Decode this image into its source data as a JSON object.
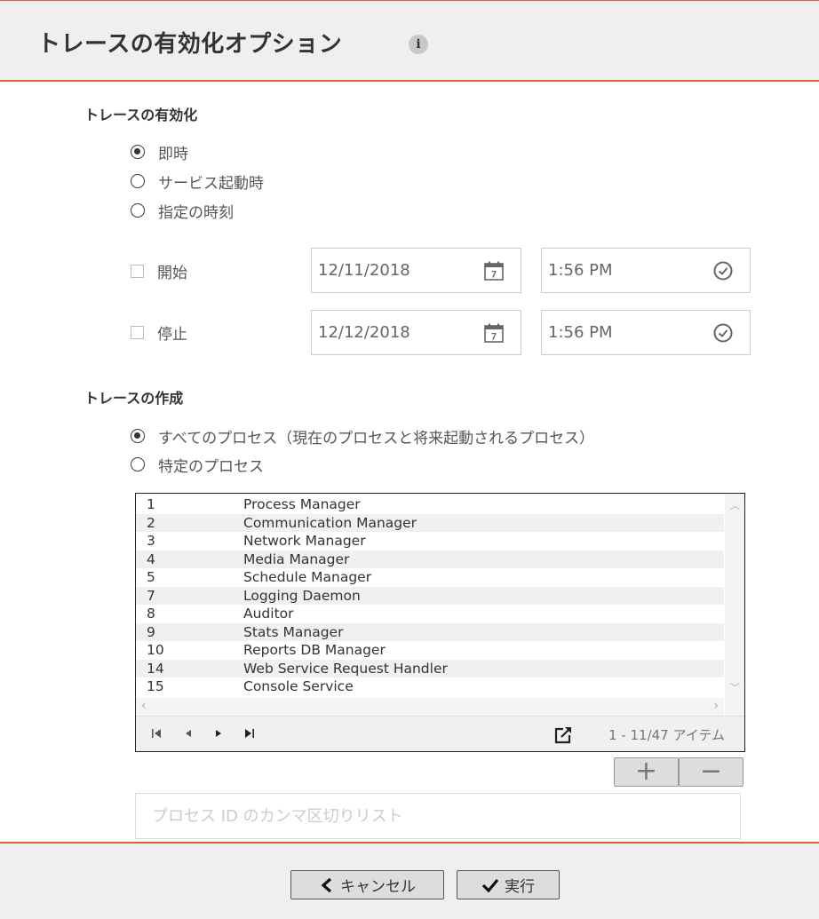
{
  "header": {
    "title": "トレースの有効化オプション",
    "info_icon": "info-icon"
  },
  "enable_section": {
    "title": "トレースの有効化",
    "options": [
      {
        "label": "即時",
        "checked": true
      },
      {
        "label": "サービス起動時",
        "checked": false
      },
      {
        "label": "指定の時刻",
        "checked": false
      }
    ],
    "start": {
      "label": "開始",
      "checked": false,
      "date": "12/11/2018",
      "time": "1:56 PM"
    },
    "stop": {
      "label": "停止",
      "checked": false,
      "date": "12/12/2018",
      "time": "1:56 PM"
    }
  },
  "create_section": {
    "title": "トレースの作成",
    "options": [
      {
        "label": "すべてのプロセス（現在のプロセスと将来起動されるプロセス）",
        "checked": true
      },
      {
        "label": "特定のプロセス",
        "checked": false
      }
    ]
  },
  "process_list": {
    "rows": [
      {
        "id": "1",
        "name": "Process Manager"
      },
      {
        "id": "2",
        "name": "Communication Manager"
      },
      {
        "id": "3",
        "name": "Network Manager"
      },
      {
        "id": "4",
        "name": "Media Manager"
      },
      {
        "id": "5",
        "name": "Schedule Manager"
      },
      {
        "id": "7",
        "name": "Logging Daemon"
      },
      {
        "id": "8",
        "name": "Auditor"
      },
      {
        "id": "9",
        "name": "Stats Manager"
      },
      {
        "id": "10",
        "name": "Reports DB Manager"
      },
      {
        "id": "14",
        "name": "Web Service Request Handler"
      },
      {
        "id": "15",
        "name": "Console Service"
      }
    ],
    "pager_info": "1 - 11/47 アイテム"
  },
  "buttons": {
    "add": "+",
    "remove": "−"
  },
  "pid_input": {
    "placeholder": "プロセス ID のカンマ区切りリスト",
    "value": ""
  },
  "footer": {
    "cancel_label": "キャンセル",
    "run_label": "実行"
  }
}
